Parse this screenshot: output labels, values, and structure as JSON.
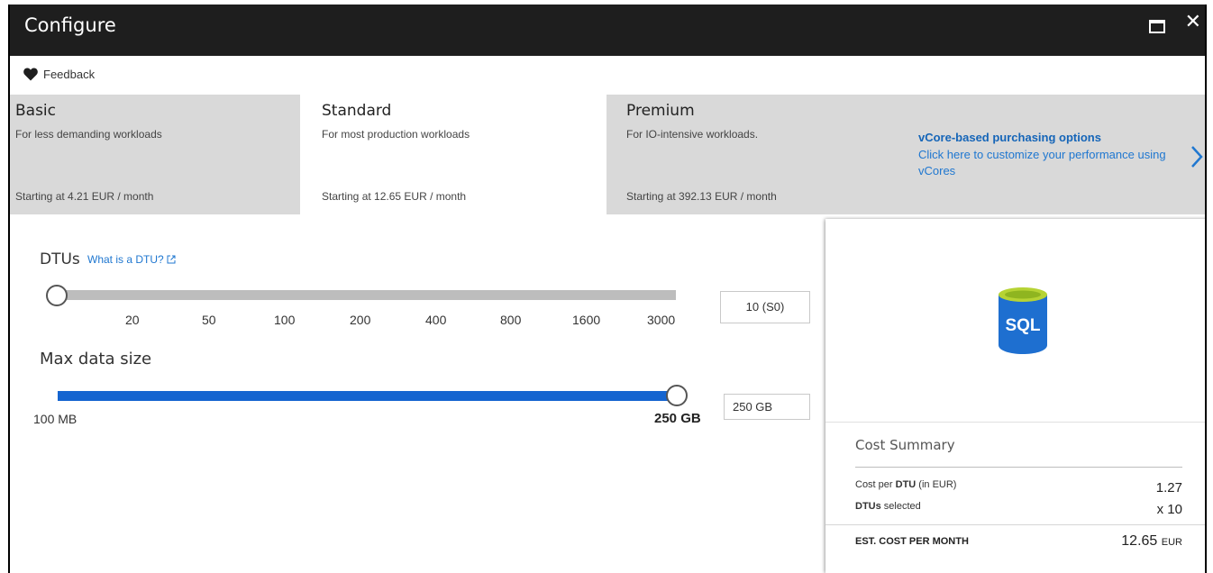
{
  "window": {
    "title": "Configure"
  },
  "commandbar": {
    "feedback_label": "Feedback"
  },
  "tiers": [
    {
      "name": "Basic",
      "description": "For less demanding workloads",
      "price": "Starting at 4.21 EUR / month",
      "selected": false
    },
    {
      "name": "Standard",
      "description": "For most production workloads",
      "price": "Starting at 12.65 EUR / month",
      "selected": true
    },
    {
      "name": "Premium",
      "description": "For IO-intensive workloads.",
      "price": "Starting at 392.13 EUR / month",
      "selected": false
    }
  ],
  "vcore": {
    "title": "vCore-based purchasing options",
    "text": "Click here to customize your performance using vCores"
  },
  "dtu": {
    "label": "DTUs",
    "link": "What is a DTU?",
    "ticks": [
      "20",
      "50",
      "100",
      "200",
      "400",
      "800",
      "1600",
      "3000"
    ],
    "value": "10 (S0)"
  },
  "max_size": {
    "label": "Max data size",
    "min_label": "100 MB",
    "max_label": "250 GB",
    "value": "250 GB"
  },
  "cost": {
    "title": "Cost Summary",
    "cost_per_dtu_prefix": "Cost per ",
    "cost_per_dtu_bold": "DTU",
    "cost_per_dtu_suffix": " (in EUR)",
    "cost_per_dtu_value": "1.27",
    "dtus_selected_bold": "DTUs",
    "dtus_selected_suffix": " selected",
    "dtus_selected_value": "x 10",
    "total_label": "EST. COST PER MONTH",
    "total_value": "12.65",
    "total_currency": "EUR"
  },
  "icons": {
    "sql_text": "SQL",
    "accent": "#1565d0",
    "link_color": "#1f77d0",
    "titlebar_color": "#1e1e1e"
  }
}
